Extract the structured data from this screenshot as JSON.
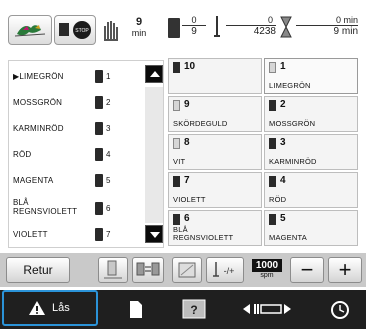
{
  "status": {
    "stitch_frac_top": "9",
    "stitch_frac_bot": "min",
    "color_frac_top": "0",
    "color_frac_bot": "9",
    "stitch_count_top": "0",
    "stitch_count_bot": "4238",
    "time_top": "0 min",
    "time_bot": "9 min"
  },
  "color_list": {
    "items": [
      {
        "name": "▶LIMEGRÖN",
        "num": "1"
      },
      {
        "name": "MOSSGRÖN",
        "num": "2"
      },
      {
        "name": "KARMINRÖD",
        "num": "3"
      },
      {
        "name": "RÖD",
        "num": "4"
      },
      {
        "name": "MAGENTA",
        "num": "5"
      },
      {
        "name": "BLÅ\nREGNSVIOLETT",
        "num": "6"
      },
      {
        "name": "VIOLETT",
        "num": "7"
      }
    ]
  },
  "grid": {
    "cells": [
      {
        "num": "10",
        "name": ""
      },
      {
        "num": "1",
        "name": "LIMEGRÖN"
      },
      {
        "num": "9",
        "name": "SKÖRDEGULD"
      },
      {
        "num": "2",
        "name": "MOSSGRÖN"
      },
      {
        "num": "8",
        "name": "VIT"
      },
      {
        "num": "3",
        "name": "KARMINRÖD"
      },
      {
        "num": "7",
        "name": "VIOLETT"
      },
      {
        "num": "4",
        "name": "RÖD"
      },
      {
        "num": "6",
        "name": "BLÅ\nREGNSVIOLETT"
      },
      {
        "num": "5",
        "name": "MAGENTA"
      }
    ]
  },
  "toolbar": {
    "retur_label": "Retur",
    "speed_value": "1000",
    "speed_unit": "spm",
    "minus_label": "−",
    "plus_label": "+"
  },
  "nav": {
    "lock_label": "Lås"
  },
  "colors": {
    "accent_blue": "#2b93d8",
    "nav_bg": "#1f1f1f"
  }
}
